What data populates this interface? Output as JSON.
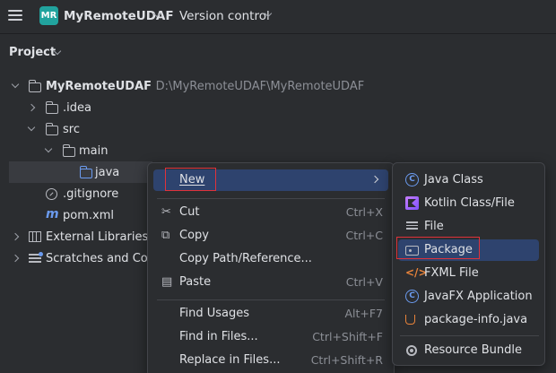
{
  "topbar": {
    "project_badge": "MR",
    "project_name": "MyRemoteUDAF",
    "version_control": "Version control"
  },
  "panel": {
    "title": "Project"
  },
  "tree": {
    "root": {
      "name": "MyRemoteUDAF",
      "path": "D:\\MyRemoteUDAF\\MyRemoteUDAF"
    },
    "idea": ".idea",
    "src": "src",
    "main": "main",
    "java": "java",
    "gitignore": ".gitignore",
    "pom": "pom.xml",
    "ext_libs": "External Libraries",
    "scratches": "Scratches and Cons"
  },
  "context_menu": {
    "new": "New",
    "cut": "Cut",
    "cut_sc": "Ctrl+X",
    "copy": "Copy",
    "copy_sc": "Ctrl+C",
    "copy_path": "Copy Path/Reference...",
    "paste": "Paste",
    "paste_sc": "Ctrl+V",
    "find_usages": "Find Usages",
    "find_usages_sc": "Alt+F7",
    "find_in_files": "Find in Files...",
    "find_in_files_sc": "Ctrl+Shift+F",
    "replace_in_files": "Replace in Files...",
    "replace_in_files_sc": "Ctrl+Shift+R"
  },
  "submenu": {
    "java_class": "Java Class",
    "kotlin": "Kotlin Class/File",
    "file": "File",
    "package": "Package",
    "fxml": "FXML File",
    "javafx": "JavaFX Application",
    "package_info": "package-info.java",
    "resource_bundle": "Resource Bundle"
  }
}
